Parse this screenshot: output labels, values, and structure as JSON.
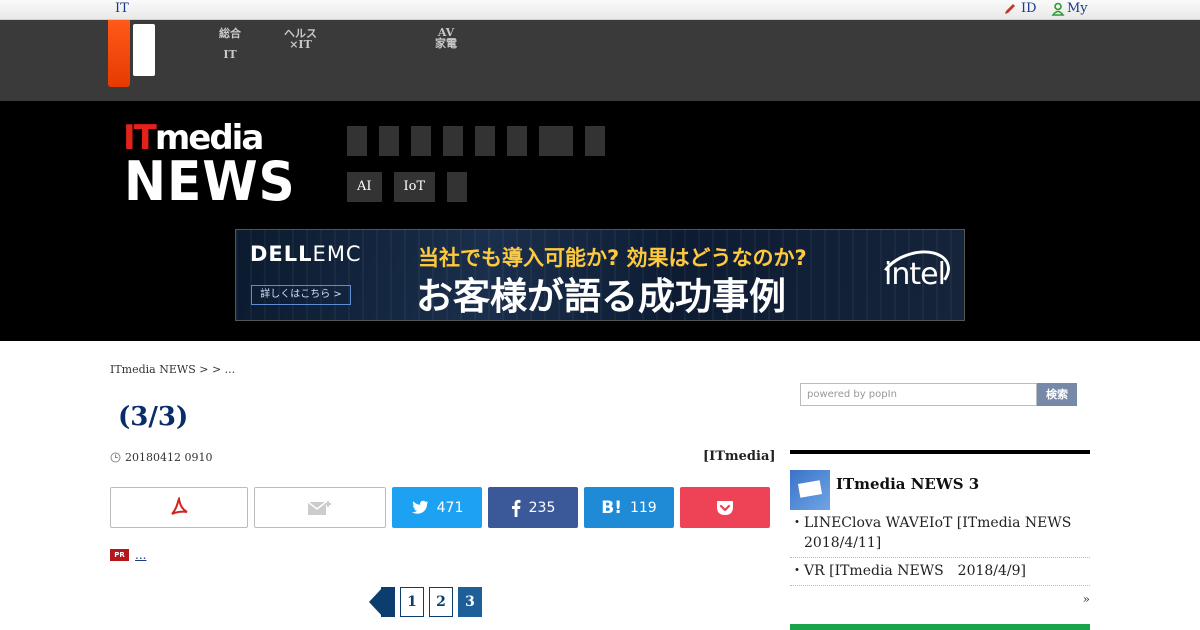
{
  "util_bar": {
    "left_label": "IT",
    "id_label": "ID",
    "my_label": "My"
  },
  "network_bar": {
    "links": [
      {
        "line1": "総合",
        "line2": "IT"
      },
      {
        "line1": "ヘルス",
        "line2": "×IT"
      },
      {
        "line1": "AV",
        "line2": "家電"
      }
    ]
  },
  "header": {
    "logo_it_red": "IT",
    "logo_it_rest": "media",
    "logo_news": "NEWS",
    "nav_row2": [
      "AI",
      "IoT"
    ]
  },
  "banner": {
    "brand": "DELL",
    "brand_suffix": "EMC",
    "cta": "詳しくはこちら >",
    "line1": "当社でも導入可能か? 効果はどうなのか?",
    "line2": "お客様が語る成功事例",
    "partner": "intel"
  },
  "main": {
    "breadcrumb": "ITmedia NEWS >  > ...",
    "title": "(3/3)",
    "date": "20180412 0910",
    "source": "[ITmedia]",
    "share": {
      "twitter_count": "471",
      "facebook_count": "235",
      "hatena_count": "119"
    },
    "pr_badge": "PR",
    "pr_link": "...  ",
    "pager": [
      "1",
      "2",
      "3"
    ],
    "current_page": "3"
  },
  "sidebar": {
    "search_placeholder": "powered by popIn",
    "search_button": "検索",
    "box_title": "ITmedia NEWS 3",
    "items": [
      "LINEClova WAVEIoT [ITmedia NEWS　2018/4/11]",
      "VR [ITmedia NEWS　2018/4/9]"
    ],
    "more": "»"
  },
  "colors": {
    "accent_red": "#e3231b",
    "twitter": "#1da1f2",
    "facebook": "#3b5998",
    "hatena": "#1f8bd6",
    "pocket": "#ee4256",
    "title_navy": "#0b2c6b"
  }
}
